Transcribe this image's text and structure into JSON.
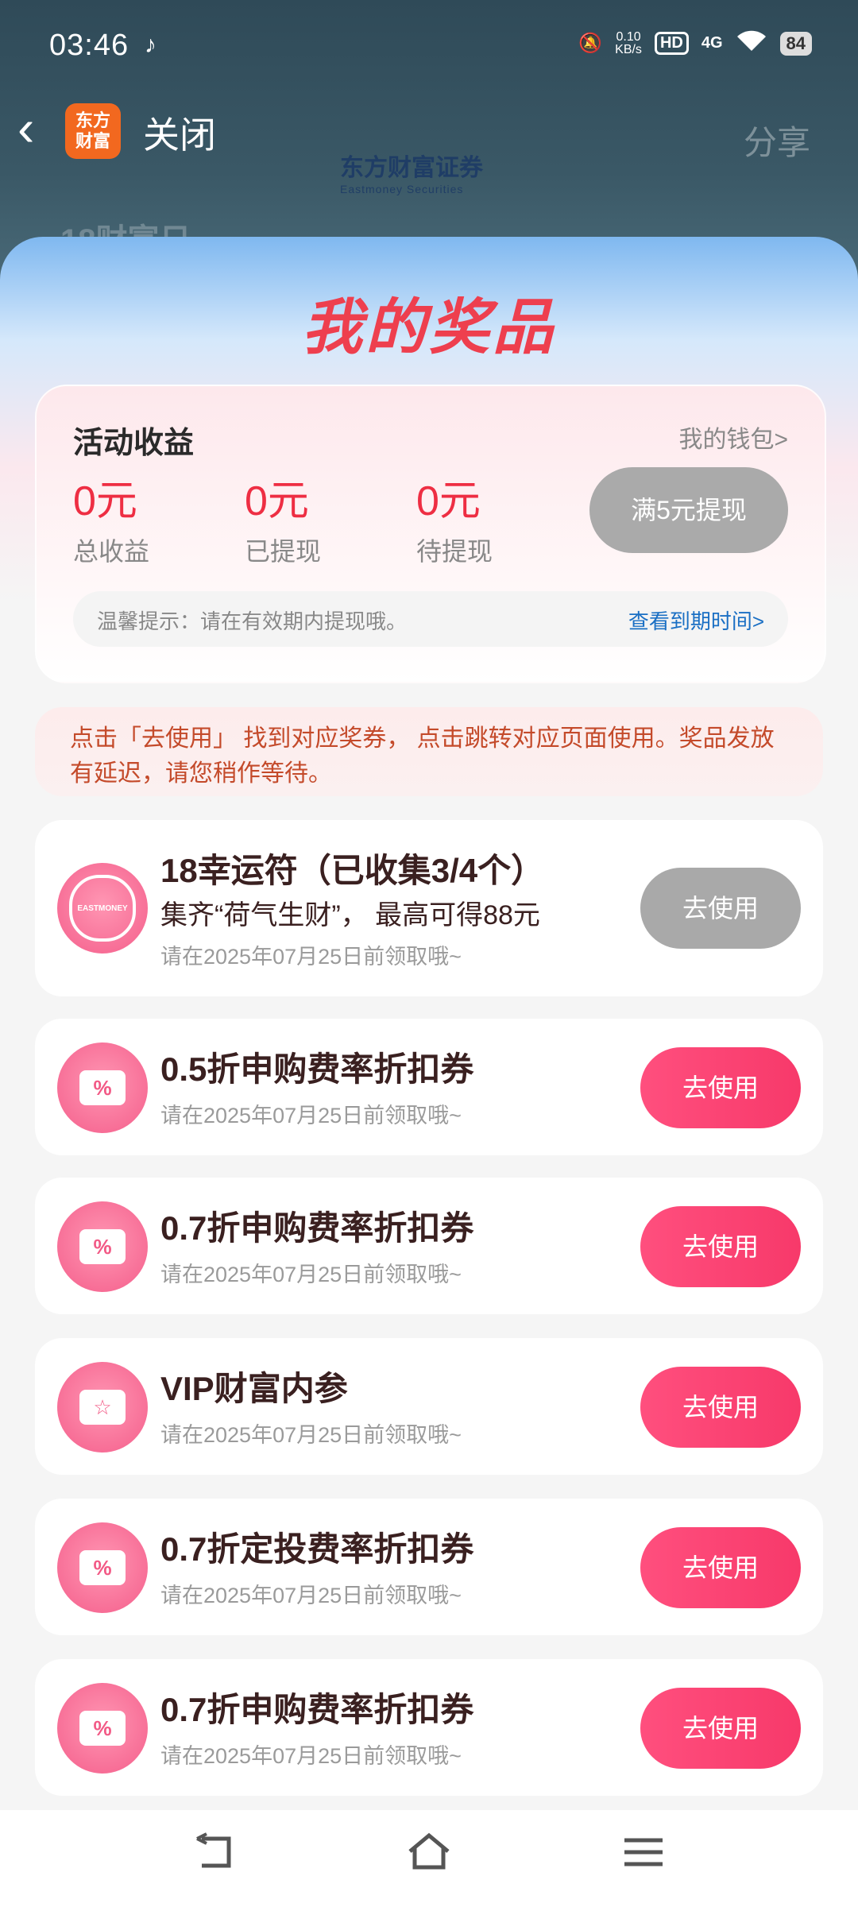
{
  "status": {
    "time": "03:46",
    "net_speed_value": "0.10",
    "net_speed_unit": "KB/s",
    "hd": "HD",
    "signal": "4G",
    "battery": "84"
  },
  "header": {
    "logo_line1": "东方",
    "logo_line2": "财富",
    "close_label": "关闭",
    "share_label": "分享",
    "brand_name": "东方财富证券",
    "brand_sub": "Eastmoney Securities",
    "faint_title": "18财富日"
  },
  "sheet": {
    "title": "我的奖品"
  },
  "earnings": {
    "title": "活动收益",
    "wallet_link": "我的钱包>",
    "stats": [
      {
        "value": "0元",
        "label": "总收益"
      },
      {
        "value": "0元",
        "label": "已提现"
      },
      {
        "value": "0元",
        "label": "待提现"
      }
    ],
    "withdraw_label": "满5元提现",
    "tip_text": "温馨提示：请在有效期内提现哦。",
    "tip_link": "查看到期时间>"
  },
  "notice": "点击「去使用」 找到对应奖券， 点击跳转对应页面使用。奖品发放有延迟，请您稍作等待。",
  "prizes": [
    {
      "name": "18幸运符（已收集3/4个）",
      "sub": "集齐“荷气生财”， 最高可得88元",
      "expiry": "请在2025年07月25日前领取哦~",
      "button": "去使用",
      "icon": "eastmoney-badge-icon",
      "badge_text": "EASTMONEY"
    },
    {
      "name": "0.5折申购费率折扣券",
      "expiry": "请在2025年07月25日前领取哦~",
      "button": "去使用",
      "icon": "percent-ticket-icon",
      "glyph": "%"
    },
    {
      "name": "0.7折申购费率折扣券",
      "expiry": "请在2025年07月25日前领取哦~",
      "button": "去使用",
      "icon": "percent-ticket-icon",
      "glyph": "%"
    },
    {
      "name": "VIP财富内参",
      "expiry": "请在2025年07月25日前领取哦~",
      "button": "去使用",
      "icon": "star-ticket-icon",
      "glyph": "☆"
    },
    {
      "name": "0.7折定投费率折扣券",
      "expiry": "请在2025年07月25日前领取哦~",
      "button": "去使用",
      "icon": "percent-ticket-icon",
      "glyph": "%"
    },
    {
      "name": "0.7折申购费率折扣券",
      "expiry": "请在2025年07月25日前领取哦~",
      "button": "去使用",
      "icon": "percent-ticket-icon",
      "glyph": "%"
    }
  ],
  "colors": {
    "accent_red": "#ee2e43",
    "button_pink": "#f7396a",
    "button_gray": "#a9a9a9",
    "link_blue": "#1a6fc4"
  }
}
